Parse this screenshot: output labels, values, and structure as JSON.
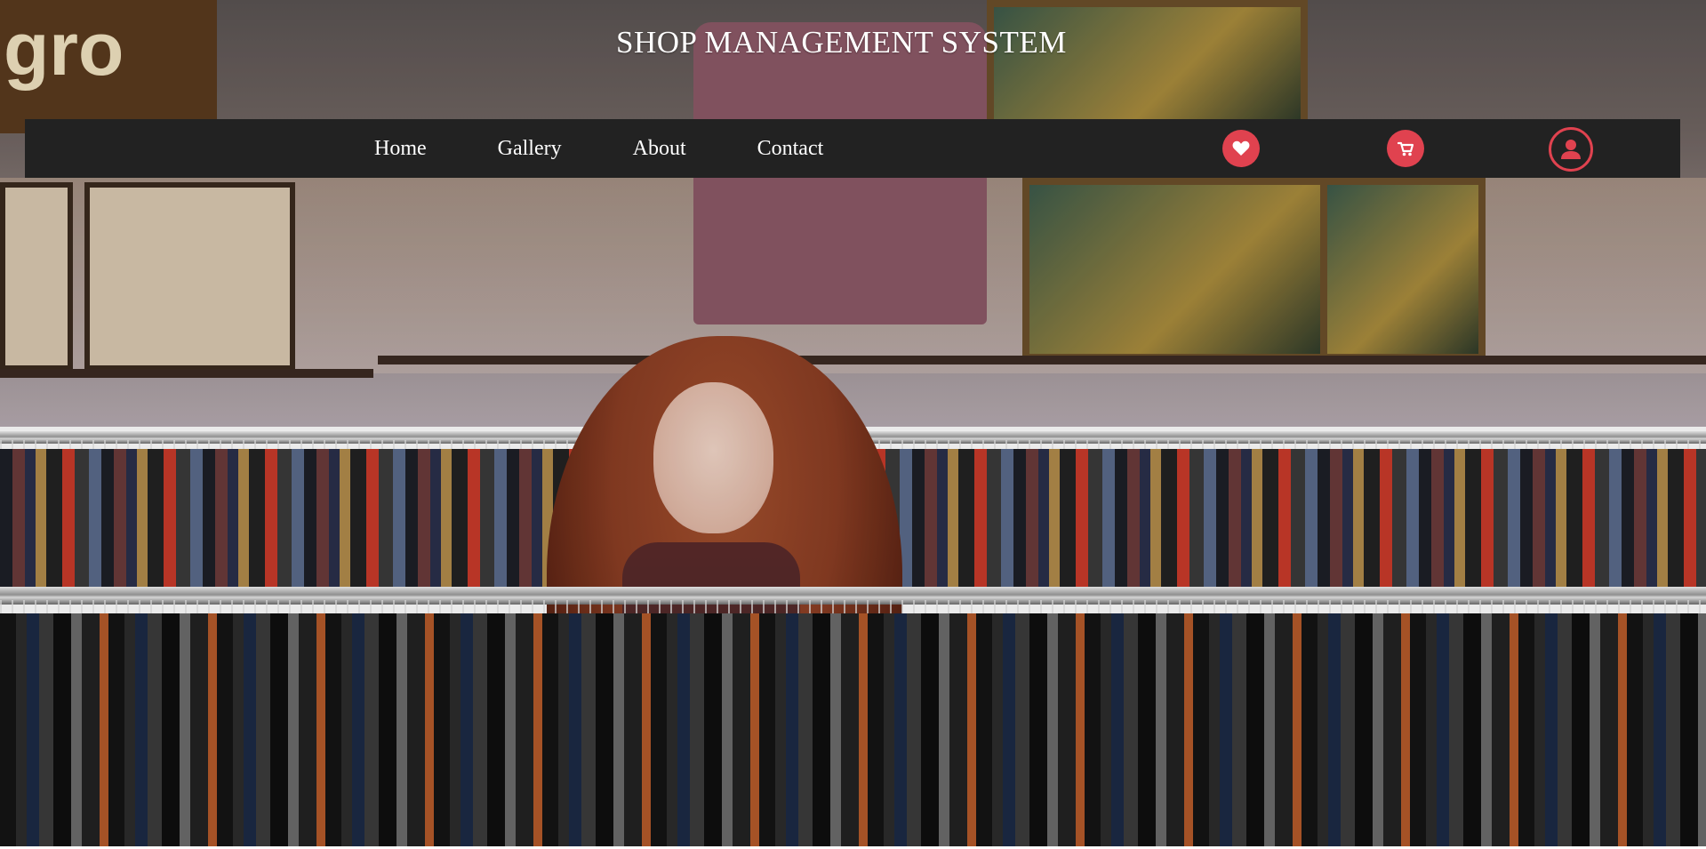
{
  "header": {
    "title": "SHOP MANAGEMENT SYSTEM"
  },
  "nav": {
    "links": [
      {
        "label": "Home"
      },
      {
        "label": "Gallery"
      },
      {
        "label": "About"
      },
      {
        "label": "Contact"
      }
    ],
    "icons": [
      {
        "name": "heart-icon",
        "label": "Wishlist"
      },
      {
        "name": "cart-icon",
        "label": "Cart"
      },
      {
        "name": "user-icon",
        "label": "Account"
      }
    ],
    "background_color": "#222222",
    "accent_color": "#e0424f"
  },
  "hero": {
    "image": "clothing-store-background"
  }
}
